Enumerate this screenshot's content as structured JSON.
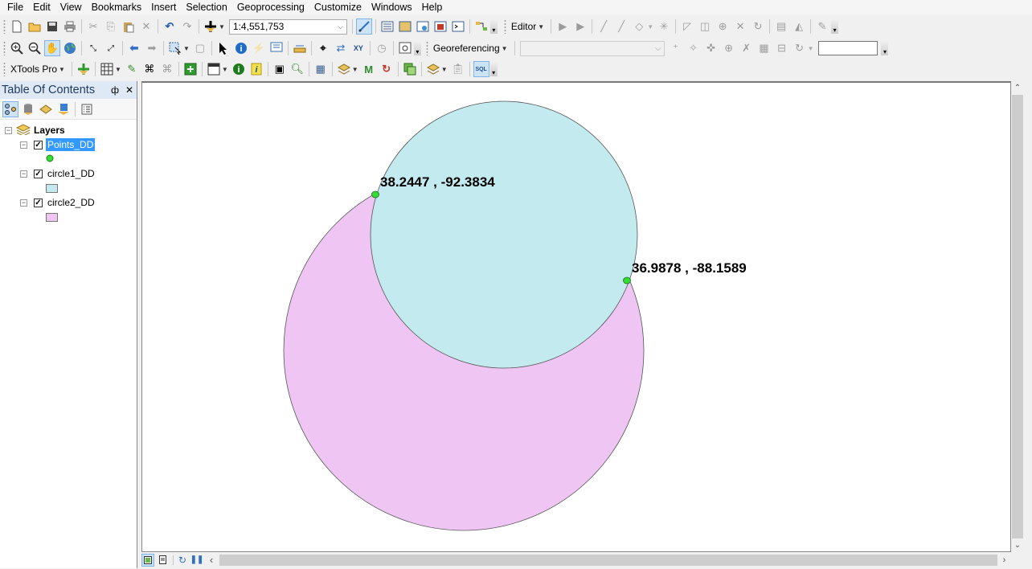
{
  "menu": [
    "File",
    "Edit",
    "View",
    "Bookmarks",
    "Insert",
    "Selection",
    "Geoprocessing",
    "Customize",
    "Windows",
    "Help"
  ],
  "toolbar": {
    "scale_value": "1:4,551,753",
    "editor_label": "Editor",
    "georeferencing_label": "Georeferencing",
    "georef_layer_value": "",
    "rotation_value": "",
    "xtools_label": "XTools Pro"
  },
  "toc": {
    "title": "Table Of Contents",
    "pin_glyph": "ф",
    "close_glyph": "✕",
    "root_label": "Layers",
    "layers": [
      {
        "name": "Points_DD",
        "checked": true,
        "selected": true,
        "symbol": "point",
        "color": "#33dd33"
      },
      {
        "name": "circle1_DD",
        "checked": true,
        "selected": false,
        "symbol": "polygon",
        "color": "#c3ebef"
      },
      {
        "name": "circle2_DD",
        "checked": true,
        "selected": false,
        "symbol": "polygon",
        "color": "#efc6f3"
      }
    ]
  },
  "map": {
    "features": {
      "circle2": {
        "fill": "#efc6f3",
        "stroke": "#555555"
      },
      "circle1": {
        "fill": "#c3ebef",
        "stroke": "#555555"
      },
      "point_color": "#33dd33"
    },
    "labels": [
      {
        "text": "38.2447 , -92.3834",
        "lat": 38.2447,
        "lon": -92.3834
      },
      {
        "text": "36.9878 , -88.1589",
        "lat": 36.9878,
        "lon": -88.1589
      }
    ]
  },
  "colors": {
    "selection": "#3399ff",
    "toc_header_bg": "#dfe9f5",
    "active_tool_bg": "#cde4f7"
  }
}
